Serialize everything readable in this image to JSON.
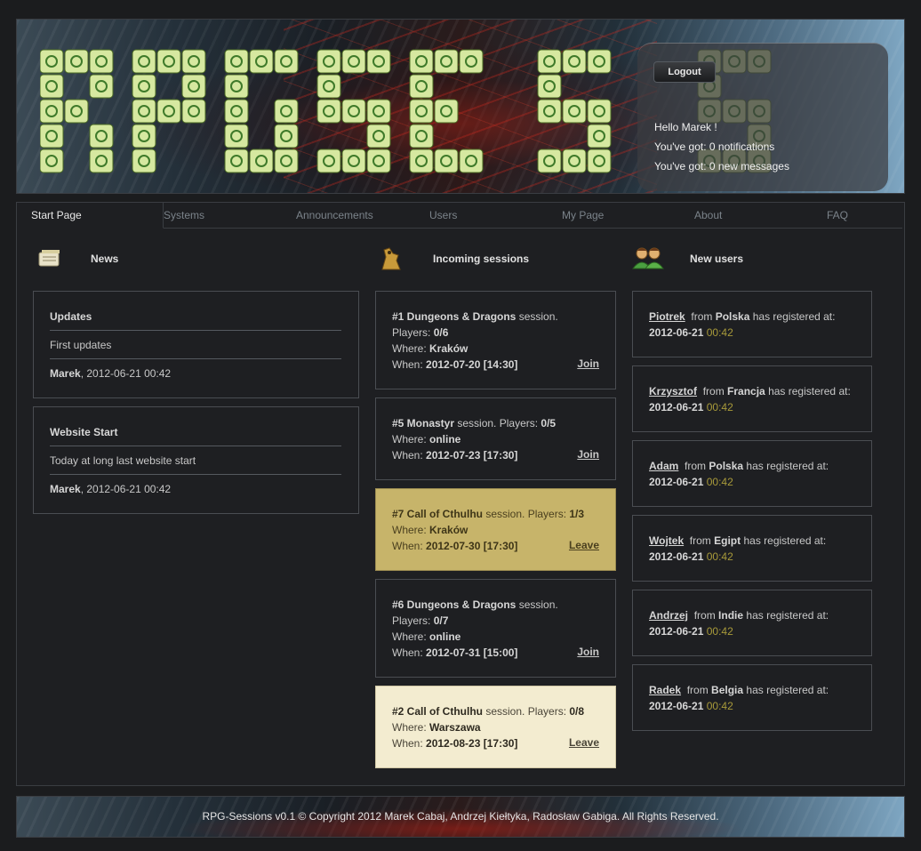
{
  "header": {
    "logo_text": "RPG-SESSIONS",
    "logout_label": "Logout",
    "greeting": "Hello Marek !",
    "notifications": "You've got: 0 notifications",
    "messages": "You've got: 0 new messages"
  },
  "tabs": [
    {
      "label": "Start Page"
    },
    {
      "label": "Systems"
    },
    {
      "label": "Announcements"
    },
    {
      "label": "Users"
    },
    {
      "label": "My Page"
    },
    {
      "label": "About"
    },
    {
      "label": "FAQ"
    }
  ],
  "news": {
    "title": "News",
    "items": [
      {
        "title": "Updates",
        "body": "First updates",
        "author": "Marek",
        "date": ", 2012-06-21 00:42"
      },
      {
        "title": "Website Start",
        "body": "Today at long last website start",
        "author": "Marek",
        "date": ", 2012-06-21 00:42"
      }
    ]
  },
  "sessions": {
    "title": "Incoming sessions",
    "items": [
      {
        "name": "#1 Dungeons & Dragons",
        "suffix": " session.",
        "players_label": "Players: ",
        "players": "0/6",
        "where_label": "Where: ",
        "where": "Kraków",
        "when_label": "When: ",
        "when": "2012-07-20 [14:30]",
        "action": "Join",
        "style": "normal"
      },
      {
        "name": "#5 Monastyr",
        "suffix": " session. Players: ",
        "players": "0/5",
        "where_label": "Where: ",
        "where": "online",
        "when_label": "When: ",
        "when": "2012-07-23 [17:30]",
        "action": "Join",
        "style": "normal"
      },
      {
        "name": "#7 Call of Cthulhu",
        "suffix": " session. Players: ",
        "players": "1/3",
        "where_label": "Where: ",
        "where": "Kraków",
        "when_label": "When: ",
        "when": "2012-07-30 [17:30]",
        "action": "Leave",
        "style": "highlight"
      },
      {
        "name": "#6 Dungeons & Dragons",
        "suffix": " session.",
        "players_label": "Players: ",
        "players": "0/7",
        "where_label": "Where: ",
        "where": "online",
        "when_label": "When: ",
        "when": "2012-07-31 [15:00]",
        "action": "Join",
        "style": "normal"
      },
      {
        "name": "#2 Call of Cthulhu",
        "suffix": " session. Players: ",
        "players": "0/8",
        "where_label": "Where: ",
        "where": "Warszawa",
        "when_label": "When: ",
        "when": "2012-08-23 [17:30]",
        "action": "Leave",
        "style": "light"
      }
    ]
  },
  "users": {
    "title": "New users",
    "from_label": "from",
    "registered_label": "has registered at:",
    "items": [
      {
        "name": "Piotrek",
        "country": "Polska",
        "date": "2012-06-21",
        "time": "00:42"
      },
      {
        "name": "Krzysztof",
        "country": "Francja",
        "date": "2012-06-21",
        "time": "00:42"
      },
      {
        "name": "Adam",
        "country": "Polska",
        "date": "2012-06-21",
        "time": "00:42"
      },
      {
        "name": "Wojtek",
        "country": "Egipt",
        "date": "2012-06-21",
        "time": "00:42"
      },
      {
        "name": "Andrzej",
        "country": "Indie",
        "date": "2012-06-21",
        "time": "00:42"
      },
      {
        "name": "Radek",
        "country": "Belgia",
        "date": "2012-06-21",
        "time": "00:42"
      }
    ]
  },
  "footer": {
    "text": "RPG-Sessions v0.1 © Copyright 2012  Marek Cabaj, Andrzej Kiełtyka, Radosław Gabiga. All Rights Reserved."
  }
}
